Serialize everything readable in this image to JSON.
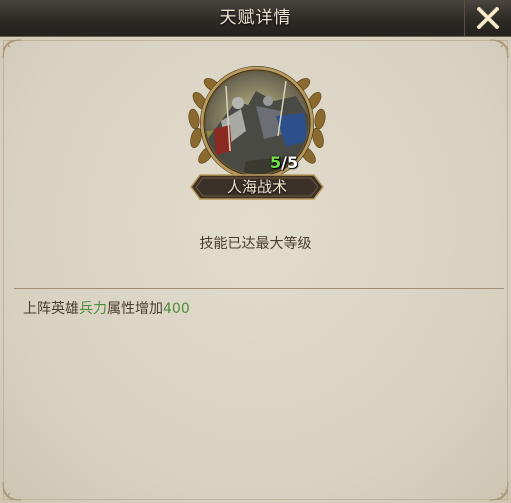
{
  "dialog": {
    "title": "天赋详情",
    "close_icon": "close-x-icon"
  },
  "talent": {
    "icon": "cavalry-battle-portrait",
    "level_current": "5",
    "level_sep": "/",
    "level_max": "5",
    "name": "人海战术",
    "status": "技能已达最大等级"
  },
  "description": {
    "prefix": "上阵英雄",
    "attribute": "兵力",
    "middle": "属性增加",
    "value": "400"
  },
  "colors": {
    "highlight_green": "#4f8b3a",
    "level_green": "#6fe04a",
    "title_text": "#efe6d2",
    "body_text": "#4a3d2c"
  }
}
